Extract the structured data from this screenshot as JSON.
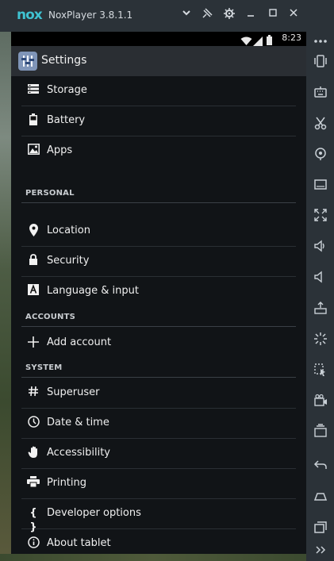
{
  "window": {
    "logo": "nox",
    "title": "NoxPlayer 3.8.1.1",
    "controls": [
      "chevron-down-icon",
      "pin-icon",
      "gear-icon",
      "minimize-icon",
      "maximize-icon",
      "close-icon"
    ]
  },
  "status_bar": {
    "time": "8:23"
  },
  "action_bar": {
    "title": "Settings"
  },
  "settings": {
    "items_top": [
      {
        "label": "Storage",
        "icon": "storage-icon"
      },
      {
        "label": "Battery",
        "icon": "battery-icon"
      },
      {
        "label": "Apps",
        "icon": "apps-icon"
      }
    ],
    "personal": {
      "header": "PERSONAL",
      "items": [
        {
          "label": "Location",
          "icon": "location-icon"
        },
        {
          "label": "Security",
          "icon": "lock-icon"
        },
        {
          "label": "Language & input",
          "icon": "keyboard-letter-icon"
        }
      ]
    },
    "accounts": {
      "header": "ACCOUNTS",
      "items": [
        {
          "label": "Add account",
          "icon": "plus-icon"
        }
      ]
    },
    "system": {
      "header": "SYSTEM",
      "items": [
        {
          "label": "Superuser",
          "icon": "hash-icon"
        },
        {
          "label": "Date & time",
          "icon": "clock-icon"
        },
        {
          "label": "Accessibility",
          "icon": "hand-icon"
        },
        {
          "label": "Printing",
          "icon": "printer-icon"
        },
        {
          "label": "Developer options",
          "icon": "braces-icon"
        },
        {
          "label": "About tablet",
          "icon": "info-icon"
        }
      ]
    }
  },
  "sidebar_tools": [
    "more-icon",
    "shake-icon",
    "keyboard-icon",
    "scissors-icon",
    "location-icon",
    "screen-icon",
    "fullscreen-icon",
    "volume-up-icon",
    "volume-down-icon",
    "apk-icon",
    "loading-icon",
    "macro-icon",
    "video-icon",
    "multi-instance-icon",
    "back-icon",
    "home-icon",
    "recent-icon",
    "expand-icon"
  ],
  "colors": {
    "accent": "#3fc2d1",
    "screen_bg": "#111417",
    "chrome": "#2b3238"
  }
}
